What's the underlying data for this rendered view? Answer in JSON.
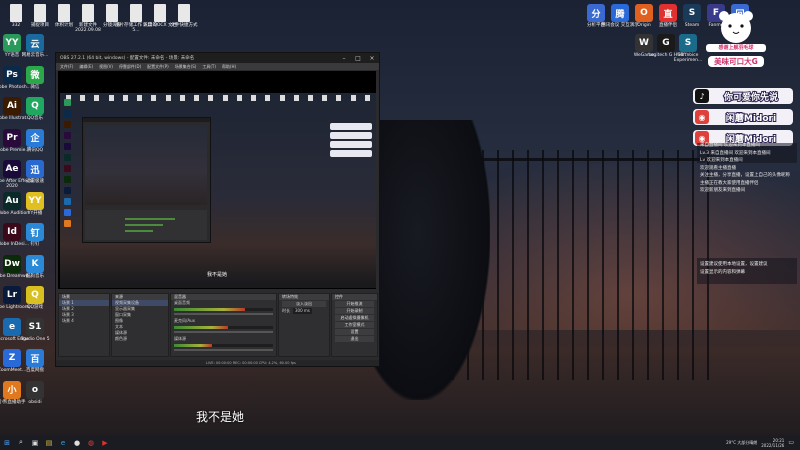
{
  "desktop": {
    "top_icons": [
      {
        "label": "332",
        "color": "#e8e8e8",
        "glyph": "document-icon"
      },
      {
        "label": "捕捉项目",
        "color": "#e8e8e8",
        "glyph": "document-icon"
      },
      {
        "label": "体积计划",
        "color": "#e8e8e8",
        "glyph": "document-icon"
      },
      {
        "label": "新建文件 2022.09.08",
        "color": "#e8e8e8",
        "glyph": "document-icon"
      },
      {
        "label": "分镜头表",
        "color": "#e8e8e8",
        "glyph": "document-icon"
      },
      {
        "label": "图片存储工作 入口的5... ",
        "color": "#e8e8e8",
        "glyph": "document-icon"
      },
      {
        "label": "新建 DOCX 文档",
        "color": "#e8e8e8",
        "glyph": "document-icon"
      },
      {
        "label": "文件快捷方式",
        "color": "#e8e8e8",
        "glyph": "document-icon"
      }
    ],
    "left_col1": [
      {
        "label": "YY语音",
        "color": "#2a9a5a",
        "text": "YY"
      },
      {
        "label": "Adobe Photosh...",
        "color": "#0b2a4a",
        "text": "Ps"
      },
      {
        "label": "Adobe Illustrat...",
        "color": "#3a1a00",
        "text": "Ai"
      },
      {
        "label": "Adobe Premie...",
        "color": "#2a0a3a",
        "text": "Pr"
      },
      {
        "label": "Adobe After Effects 2020",
        "color": "#1a0a3a",
        "text": "Ae"
      },
      {
        "label": "Adobe Audition",
        "color": "#0a2a2a",
        "text": "Au"
      },
      {
        "label": "Adobe InDesi...",
        "color": "#3a0a1a",
        "text": "Id"
      },
      {
        "label": "Adobe Dreamwe...",
        "color": "#0a2a0a",
        "text": "Dw"
      },
      {
        "label": "Adobe Lightroom...",
        "color": "#0a1a3a",
        "text": "Lr"
      },
      {
        "label": "Microsoft Edge",
        "color": "#1a6ab0",
        "text": "e"
      },
      {
        "label": "ZoomMeet...",
        "color": "#2a6ad8",
        "text": "Z"
      },
      {
        "label": "小熊直播助手",
        "color": "#e07820",
        "text": "小"
      }
    ],
    "left_col2": [
      {
        "label": "网易云音乐...",
        "color": "#1a6aa0",
        "text": "云"
      },
      {
        "label": "微信",
        "color": "#2aa84a",
        "text": "微"
      },
      {
        "label": "QQ音乐",
        "color": "#20a860",
        "text": "Q"
      },
      {
        "label": "腾讯QQ",
        "color": "#2a7ad8",
        "text": "企"
      },
      {
        "label": "迅雷极速",
        "color": "#2a6ad0",
        "text": "迅"
      },
      {
        "label": "YY开播",
        "color": "#e0c020",
        "text": "YY"
      },
      {
        "label": "钉钉",
        "color": "#2a8ad8",
        "text": "钉"
      },
      {
        "label": "酷狗音乐",
        "color": "#2a8ad8",
        "text": "K"
      },
      {
        "label": "QQ游戏",
        "color": "#d8c020",
        "text": "Q"
      },
      {
        "label": "Studio One 5",
        "color": "#333333",
        "text": "S1"
      },
      {
        "label": "百度网盘",
        "color": "#2a7ad8",
        "text": "百"
      },
      {
        "label": "obsidi",
        "color": "#333333",
        "text": "o"
      }
    ],
    "right_icons_row1": [
      {
        "label": "分析平台",
        "color": "#3a6ad0",
        "text": "分"
      },
      {
        "label": "腾讯会议 交互演示",
        "color": "#2a6ad8",
        "text": "腾"
      },
      {
        "label": "Origin",
        "color": "#e06020",
        "text": "O"
      },
      {
        "label": "直播伴侣",
        "color": "#e03030",
        "text": "直"
      },
      {
        "label": "Steam",
        "color": "#1a3a5a",
        "text": "S"
      },
      {
        "label": "Fanmo",
        "color": "#3a3a8a",
        "text": "F"
      },
      {
        "label": "回收站",
        "color": "#3a6ad0",
        "text": "回"
      }
    ],
    "right_icons_row2": [
      {
        "label": "WeGame",
        "color": "#333333",
        "text": "W"
      },
      {
        "label": "Logitech G HUB",
        "color": "#1a1a1a",
        "text": "G"
      },
      {
        "label": "SoftVoice Experimen...",
        "color": "#1a6a8a",
        "text": "S"
      }
    ]
  },
  "sticker": {
    "line1": "感谢上舰羽毛球",
    "line2": "美味可口大G"
  },
  "chat": {
    "banners": [
      {
        "icon": "douyin-icon",
        "icon_color": "#111111",
        "text": "你可爱你先说"
      },
      {
        "icon": "weibo-icon",
        "icon_color": "#e0403a",
        "text": "闲蘑Midori"
      },
      {
        "icon": "weibo-icon",
        "icon_color": "#e0403a",
        "text": "闲蘑Midori"
      }
    ],
    "messages": [
      "来自直播间 欢迎来到本直播间",
      "Lv.3 来自直播间 欢迎来到本直播间",
      "Lv 欢迎来到本直播间",
      "欢迎观看主播直播",
      "关注主播，分享直播，设置上自己的头像昵称",
      "主播正在教大家使用直播伴侣",
      "欢迎新朋友来到直播间"
    ],
    "messages2": [
      "设置建议使用本地设置，设置建议",
      "设置显示的内容和弹幕"
    ]
  },
  "obs": {
    "title": "OBS 27.2.1 (64 bit, windows) - 配置文件: 未命名 - 场景: 未命名",
    "menu": [
      "文件(F)",
      "编辑(E)",
      "视图(V)",
      "停靠部件(D)",
      "配置文件(P)",
      "场景集合(S)",
      "工具(T)",
      "帮助(H)"
    ],
    "preview_caption": "我不是她",
    "panels": {
      "scenes_title": "场景",
      "sources_title": "来源",
      "mixer_title": "混音器",
      "transitions_title": "转场特效",
      "controls_title": "控件",
      "scene_items": [
        "场景 1",
        "场景 2",
        "场景 3",
        "场景 4"
      ],
      "source_items": [
        "视频采集设备",
        "显示器采集",
        "窗口采集",
        "图像",
        "文本",
        "媒体源",
        "颜色源"
      ],
      "mixer_tracks": [
        {
          "name": "桌面音频",
          "level": 0.72
        },
        {
          "name": "麦克风/Aux",
          "level": 0.55
        },
        {
          "name": "媒体源",
          "level": 0.38
        }
      ],
      "transition_value": "淡入淡出",
      "duration_label": "时长",
      "duration_value": "300 ms",
      "control_buttons": [
        "开始推流",
        "开始录制",
        "启动虚拟摄像机",
        "工作室模式",
        "设置",
        "退出"
      ]
    },
    "status": "LIVE: 00:00:00   REC: 00:00:00   CPU: 4.2%, 60.00 fps"
  },
  "subtitle": "我不是她",
  "taskbar": {
    "items": [
      "start-icon",
      "search-icon",
      "task-view-icon",
      "file-explorer-icon",
      "edge-icon",
      "obs-icon",
      "chrome-icon",
      "live-app-icon"
    ],
    "tray_text": "29°C 大部分晴朗",
    "time": "20:21",
    "date": "2022/11/26"
  }
}
